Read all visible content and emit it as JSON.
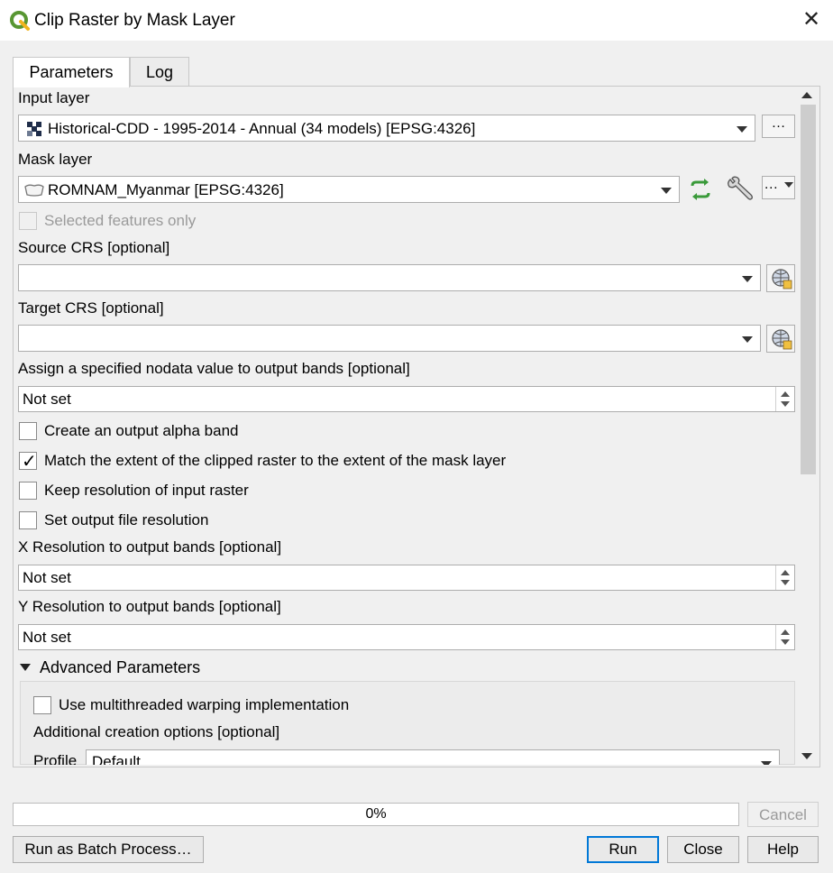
{
  "window": {
    "title": "Clip Raster by Mask Layer",
    "close_glyph": "✕",
    "icon": "qgis-logo-icon"
  },
  "tabs": [
    {
      "label": "Parameters",
      "active": true
    },
    {
      "label": "Log",
      "active": false
    }
  ],
  "params": {
    "input_layer": {
      "label": "Input layer",
      "value": "Historical-CDD - 1995-2014   - Annual (34 models) [EPSG:4326]",
      "browse": "…"
    },
    "mask_layer": {
      "label": "Mask layer",
      "value": "ROMNAM_Myanmar [EPSG:4326]",
      "browse": "…"
    },
    "selected_only": {
      "label": "Selected features only",
      "checked": false,
      "enabled": false
    },
    "source_crs": {
      "label": "Source CRS [optional]",
      "value": ""
    },
    "target_crs": {
      "label": "Target CRS [optional]",
      "value": ""
    },
    "nodata": {
      "label": "Assign a specified nodata value to output bands [optional]",
      "value": "Not set"
    },
    "alpha_band": {
      "label": "Create an output alpha band",
      "checked": false
    },
    "match_extent": {
      "label": "Match the extent of the clipped raster to the extent of the mask layer",
      "checked": true
    },
    "keep_resolution": {
      "label": "Keep resolution of input raster",
      "checked": false
    },
    "set_resolution": {
      "label": "Set output file resolution",
      "checked": false
    },
    "x_res": {
      "label": "X Resolution to output bands [optional]",
      "value": "Not set"
    },
    "y_res": {
      "label": "Y Resolution to output bands [optional]",
      "value": "Not set"
    },
    "advanced": {
      "header": "Advanced Parameters",
      "multithread": {
        "label": "Use multithreaded warping implementation",
        "checked": false
      },
      "creation_options_label": "Additional creation options [optional]",
      "profile_label": "Profile",
      "profile_value": "Default"
    }
  },
  "progress": {
    "text": "0%",
    "value": 0
  },
  "buttons": {
    "cancel": "Cancel",
    "batch": "Run as Batch Process…",
    "run": "Run",
    "close": "Close",
    "help": "Help"
  },
  "colors": {
    "accent": "#0078d7",
    "qgis_green": "#589632",
    "qgis_yellow": "#f0b41e"
  }
}
